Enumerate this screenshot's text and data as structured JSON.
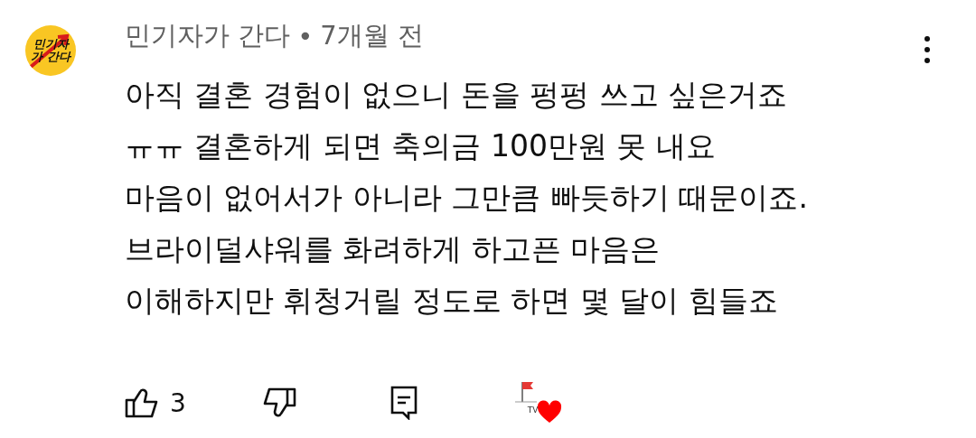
{
  "comment": {
    "avatar_text": "민기자가 간다",
    "author": "민기자가 간다",
    "separator": "•",
    "time": "7개월 전",
    "lines": [
      "아직 결혼 경험이 없으니 돈을 펑펑 쓰고 싶은거죠",
      "ㅠㅠ 결혼하게 되면 축의금 100만원 못 내요",
      "마음이 없어서가 아니라 그만큼 빠듯하기 때문이죠.",
      "브라이덜샤워를 화려하게 하고픈 마음은",
      "이해하지만 휘청거릴 정도로 하면 몇 달이 힘들죠"
    ],
    "like_count": "3",
    "creator_heart": {
      "label": "TV",
      "hearted": true
    }
  }
}
